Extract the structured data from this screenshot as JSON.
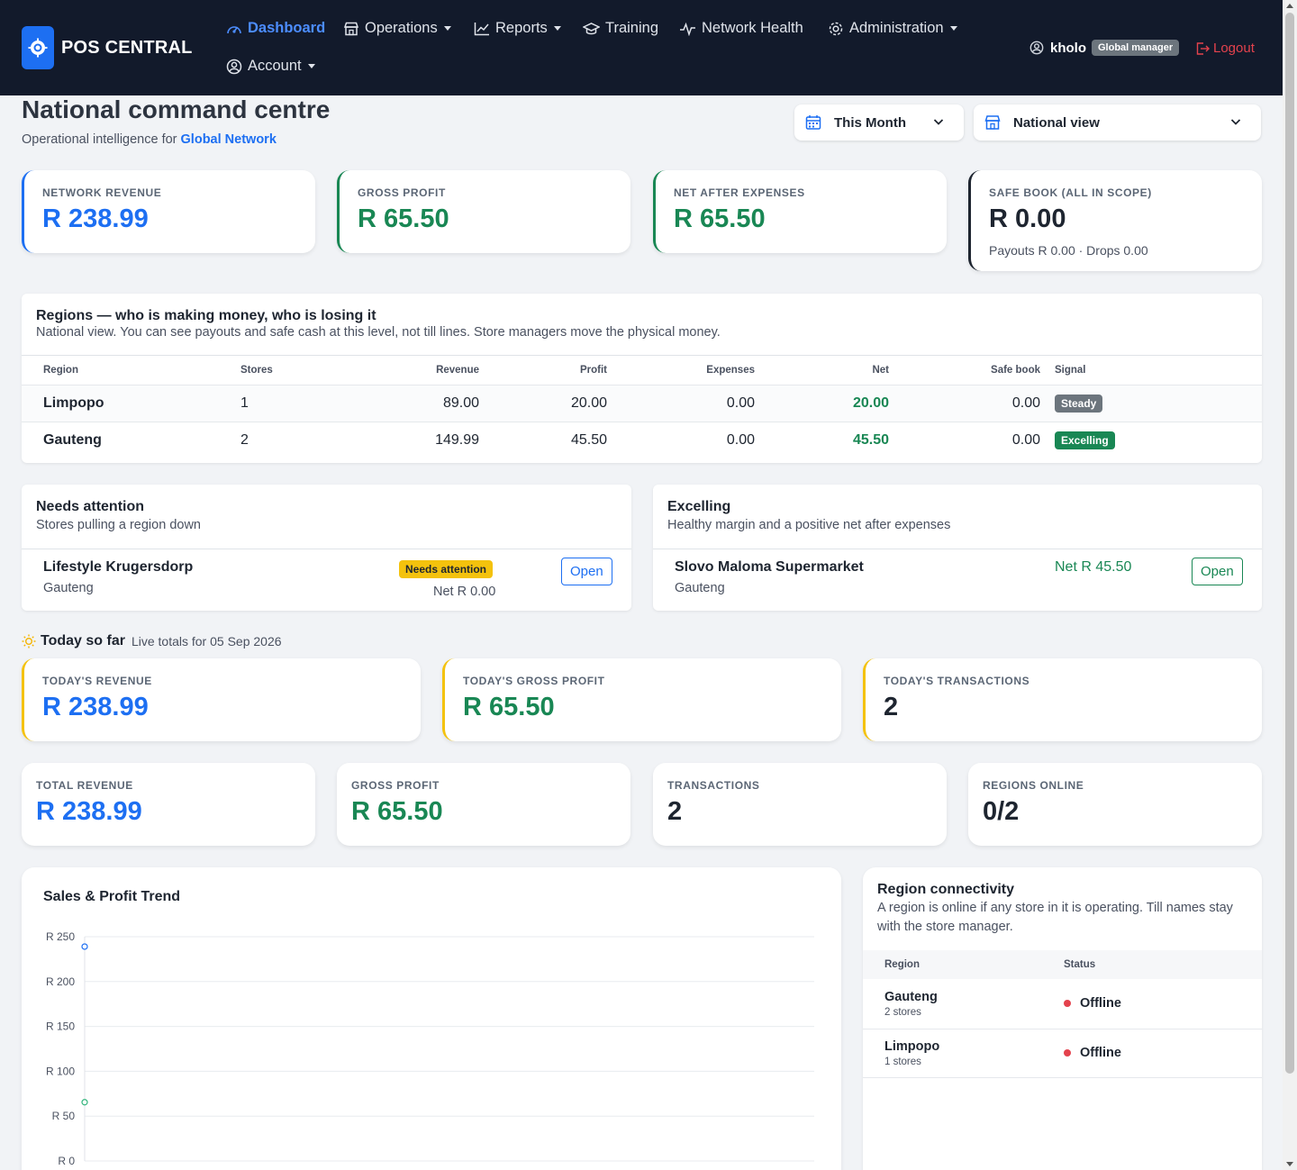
{
  "brand": {
    "name": "POS CENTRAL",
    "logo_icon": "gear-chip-icon"
  },
  "nav": {
    "items": [
      {
        "label": "Dashboard",
        "icon": "speedometer-icon",
        "active": true,
        "dropdown": false
      },
      {
        "label": "Operations",
        "icon": "shop-icon",
        "dropdown": true
      },
      {
        "label": "Reports",
        "icon": "graph-icon",
        "dropdown": true
      },
      {
        "label": "Training",
        "icon": "mortarboard-icon",
        "dropdown": false
      },
      {
        "label": "Network Health",
        "icon": "pulse-icon",
        "dropdown": false
      },
      {
        "label": "Administration",
        "icon": "gear-icon",
        "dropdown": true
      },
      {
        "label": "Account",
        "icon": "person-circle-icon",
        "dropdown": true
      }
    ],
    "user": {
      "name": "kholo",
      "role": "Global manager"
    },
    "logout": "Logout"
  },
  "header": {
    "title": "National command centre",
    "subtitle_prefix": "Operational intelligence for",
    "scope": "Global Network",
    "period_select": "This Month",
    "view_select": "National view"
  },
  "kpis": [
    {
      "label": "NETWORK REVENUE",
      "value": "R 238.99"
    },
    {
      "label": "GROSS PROFIT",
      "value": "R 65.50"
    },
    {
      "label": "NET AFTER EXPENSES",
      "value": "R 65.50"
    },
    {
      "label": "SAFE BOOK (ALL IN SCOPE)",
      "value": "R 0.00",
      "foot": "Payouts R 0.00 · Drops 0.00"
    }
  ],
  "regions": {
    "title": "Regions — who is making money, who is losing it",
    "subtitle": "National view. You can see payouts and safe cash at this level, not till lines. Store managers move the physical money.",
    "columns": [
      "Region",
      "Stores",
      "Revenue",
      "Profit",
      "Expenses",
      "Net",
      "Safe book",
      "Signal"
    ],
    "rows": [
      {
        "region": "Limpopo",
        "stores": "1",
        "revenue": "89.00",
        "profit": "20.00",
        "expenses": "0.00",
        "net": "20.00",
        "safe": "0.00",
        "signal": "Steady"
      },
      {
        "region": "Gauteng",
        "stores": "2",
        "revenue": "149.99",
        "profit": "45.50",
        "expenses": "0.00",
        "net": "45.50",
        "safe": "0.00",
        "signal": "Excelling"
      }
    ],
    "signal_colors": {
      "Steady": "#6c757d",
      "Excelling": "#198754"
    }
  },
  "needs_attention": {
    "title": "Needs attention",
    "subtitle": "Stores pulling a region down",
    "store": "Lifestyle Krugersdorp",
    "region": "Gauteng",
    "badge": "Needs attention",
    "net": "Net R 0.00",
    "button": "Open"
  },
  "excelling": {
    "title": "Excelling",
    "subtitle": "Healthy margin and a positive net after expenses",
    "store": "Slovo Maloma Supermarket",
    "region": "Gauteng",
    "net": "Net R 45.50",
    "button": "Open"
  },
  "today": {
    "title": "Today so far",
    "subtitle": "Live totals for 05 Sep 2026",
    "icon": "sun-icon",
    "cards": [
      {
        "label": "TODAY'S REVENUE",
        "value": "R 238.99"
      },
      {
        "label": "TODAY'S GROSS PROFIT",
        "value": "R 65.50"
      },
      {
        "label": "TODAY'S TRANSACTIONS",
        "value": "2"
      }
    ]
  },
  "totals": [
    {
      "label": "TOTAL REVENUE",
      "value": "R 238.99"
    },
    {
      "label": "GROSS PROFIT",
      "value": "R 65.50"
    },
    {
      "label": "TRANSACTIONS",
      "value": "2"
    },
    {
      "label": "REGIONS ONLINE",
      "value": "0/2"
    }
  ],
  "chart": {
    "title": "Sales & Profit Trend"
  },
  "chart_data": {
    "type": "line",
    "title": "Sales & Profit Trend",
    "y_ticks": [
      "R 250",
      "R 200",
      "R 150",
      "R 100",
      "R 50",
      "R 0"
    ],
    "ylim": [
      0,
      250
    ],
    "grid": true,
    "series": [
      {
        "values": [
          238.99
        ],
        "color": "#1d6ff2"
      },
      {
        "values": [
          65.5
        ],
        "color": "#2fb37a"
      }
    ]
  },
  "connectivity": {
    "title": "Region connectivity",
    "subtitle": "A region is online if any store in it is operating. Till names stay with the store manager.",
    "columns": [
      "Region",
      "Status"
    ],
    "rows": [
      {
        "region": "Gauteng",
        "stores": "2 stores",
        "status": "Offline"
      },
      {
        "region": "Limpopo",
        "stores": "1 stores",
        "status": "Offline"
      }
    ]
  }
}
